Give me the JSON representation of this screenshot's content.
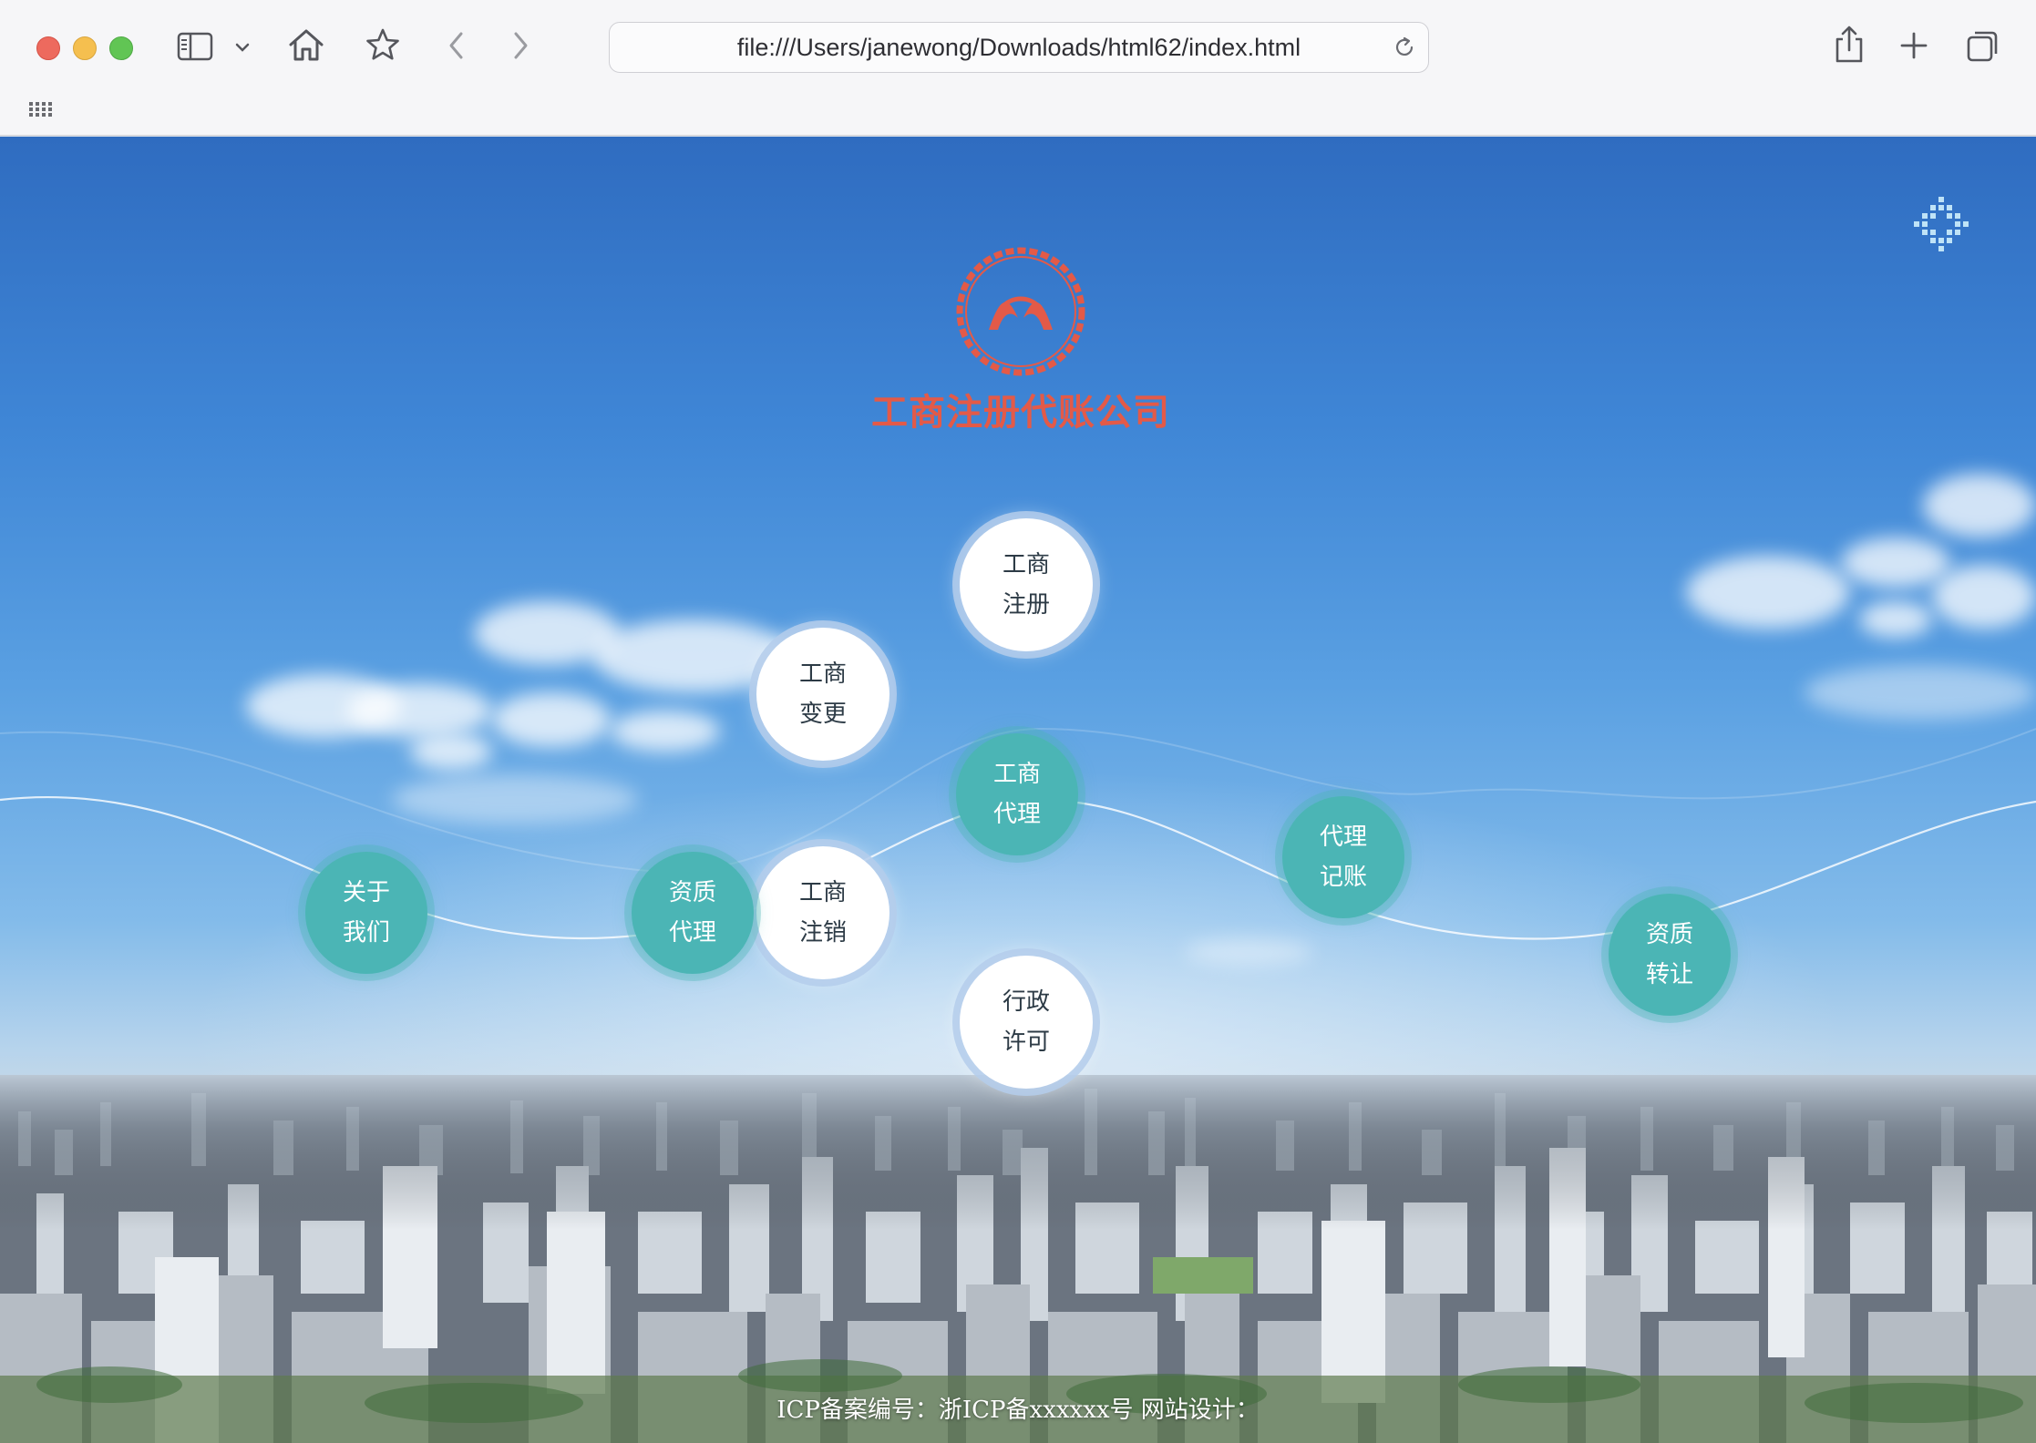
{
  "browser": {
    "url": "file:///Users/janewong/Downloads/html62/index.html",
    "icons": {
      "sidebar": "sidebar-icon",
      "dropdown": "chevron-down-icon",
      "home": "home-icon",
      "bookmark": "star-icon",
      "back": "chevron-left-icon",
      "forward": "chevron-right-icon",
      "reload": "reload-icon",
      "share": "share-icon",
      "new_tab": "plus-icon",
      "tabs": "tab-overview-icon",
      "favorites": "grid-icon"
    }
  },
  "site": {
    "logo_title": "工商注册代账公司",
    "brand_color": "#e35a48",
    "accent_teal": "#4bb5b5",
    "nav": {
      "gongshang_zhuce": [
        "工商",
        "注册"
      ],
      "gongshang_biangeng": [
        "工商",
        "变更"
      ],
      "gongshang_daili": [
        "工商",
        "代理"
      ],
      "gongshang_zhuxiao": [
        "工商",
        "注销"
      ],
      "xingzheng_xuke": [
        "行政",
        "许可"
      ],
      "guanyu_women": [
        "关于",
        "我们"
      ],
      "zizhi_daili": [
        "资质",
        "代理"
      ],
      "daili_jizhang": [
        "代理",
        "记账"
      ],
      "zizhi_zhuanrang": [
        "资质",
        "转让"
      ]
    },
    "footer": "ICP备案编号：浙ICP备xxxxxx号 网站设计：",
    "menu_icon": "dots-menu-icon"
  }
}
